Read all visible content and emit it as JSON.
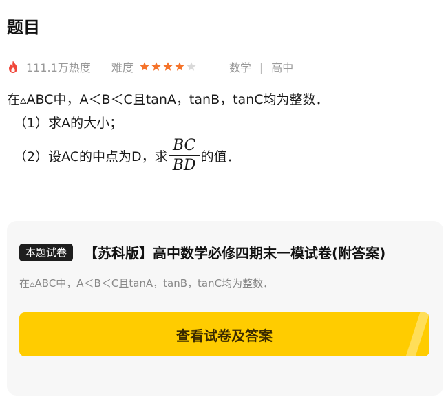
{
  "header": {
    "title": "题目"
  },
  "meta": {
    "heat": "111.1万热度",
    "difficulty_label": "难度",
    "difficulty_stars": 4,
    "difficulty_max": 5,
    "subject": "数学",
    "separator": "|",
    "level": "高中",
    "star_color_on": "#f5732a",
    "star_color_off": "#d9d9d9"
  },
  "question": {
    "stem": "在▵ABC中，A＜B＜C且tanA，tanB，tanC均为整数．",
    "part1": "（1）求A的大小；",
    "part2_prefix": "（2）设AC的中点为D，求",
    "fraction_numerator": "BC",
    "fraction_denominator": "BD",
    "part2_suffix": "的值．"
  },
  "paper_card": {
    "badge": "本题试卷",
    "title": "【苏科版】高中数学必修四期末一模试卷(附答案)",
    "description": "在▵ABC中，A＜B＜C且tanA，tanB，tanC均为整数．",
    "button_label": "查看试卷及答案",
    "button_color": "#ffcc00"
  }
}
